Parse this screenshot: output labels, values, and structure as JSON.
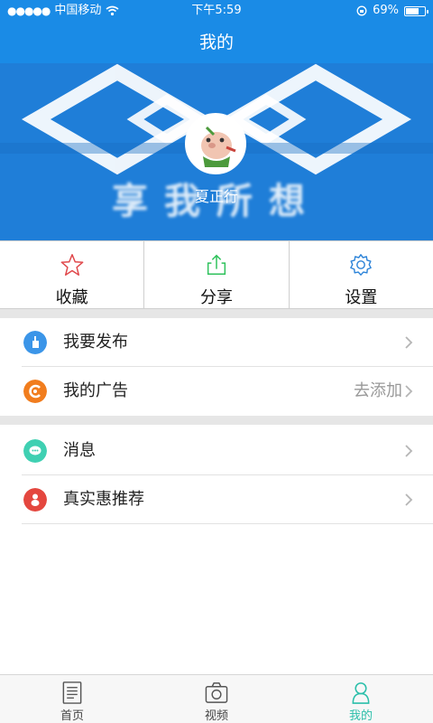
{
  "status_bar": {
    "carrier": "中国移动",
    "time": "下午5:59",
    "battery": "69%",
    "battery_level": 0.69
  },
  "header": {
    "title": "我的"
  },
  "profile": {
    "username": "夏正行",
    "banner_slogan": "享我所想"
  },
  "actions": [
    {
      "label": "收藏",
      "icon": "star-icon"
    },
    {
      "label": "分享",
      "icon": "share-icon"
    },
    {
      "label": "设置",
      "icon": "gear-icon"
    }
  ],
  "menu_groups": [
    [
      {
        "label": "我要发布",
        "icon": "hand-icon",
        "color": "#3b95e8",
        "hint": ""
      },
      {
        "label": "我的广告",
        "icon": "ad-icon",
        "color": "#f17d1e",
        "hint": "去添加"
      }
    ],
    [
      {
        "label": "消息",
        "icon": "message-icon",
        "color": "#3fd0b2",
        "hint": ""
      },
      {
        "label": "真实惠推荐",
        "icon": "recommend-icon",
        "color": "#e4473f",
        "hint": ""
      }
    ]
  ],
  "tabs": [
    {
      "label": "首页",
      "icon": "home-doc-icon",
      "active": false
    },
    {
      "label": "视频",
      "icon": "camera-icon",
      "active": false
    },
    {
      "label": "我的",
      "icon": "person-icon",
      "active": true
    }
  ],
  "colors": {
    "primary": "#1a8be6",
    "active_tab": "#2bbfaa"
  }
}
